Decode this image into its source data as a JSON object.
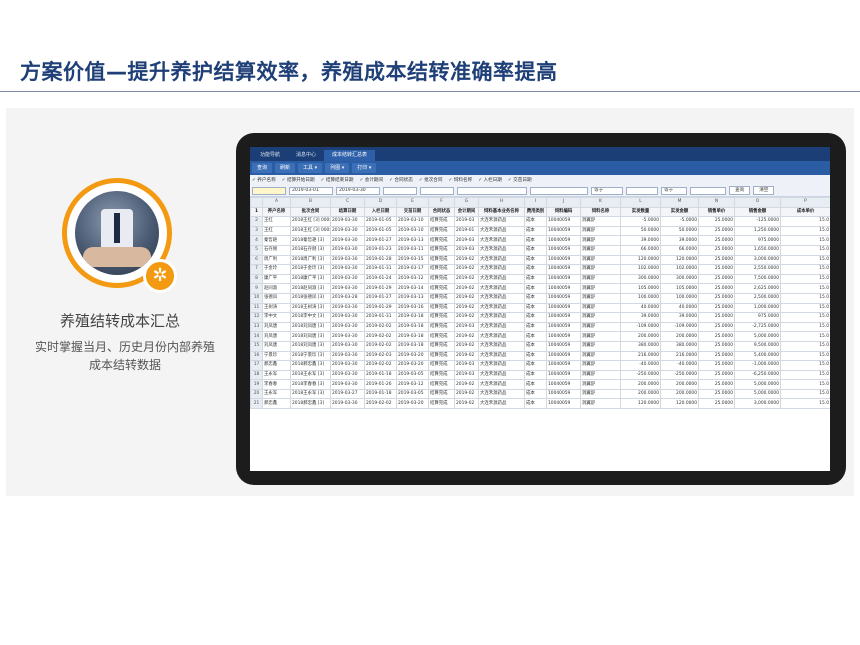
{
  "slide": {
    "title": "方案价值—提升养护结算效率，养殖成本结转准确率提高",
    "feature_title": "养殖结转成本汇总",
    "feature_desc_line1": "实时掌握当月、历史月份内部养殖",
    "feature_desc_line2": "成本结转数据",
    "badge_icon": "aperture-icon"
  },
  "colors": {
    "title": "#1f3f77",
    "accent": "#f39a12",
    "app_header": "#1a3e75",
    "app_toolbar": "#2a5da3"
  },
  "app": {
    "tabs": [
      "功能导航",
      "消息中心",
      "成本结转汇总表"
    ],
    "active_tab": 2,
    "toolbar": [
      "查询",
      "刷新",
      "工具 ▾",
      "列图 ▾",
      "打印 ▾"
    ],
    "filters": [
      "养户名称",
      "结算开始日期",
      "结算结束日期",
      "会计期间",
      "合同状态",
      "批次合同",
      "饲料名称",
      "入栏日期",
      "交苗日期"
    ],
    "filter_values": {
      "start_date": "2019-03-01",
      "end_date": "2019-03-30",
      "op1": "等于",
      "op2": "等于"
    },
    "buttons": {
      "query": "查询",
      "clear": "清空"
    },
    "column_letters": [
      "A",
      "B",
      "C",
      "D",
      "E",
      "F",
      "G",
      "H",
      "I",
      "J",
      "K",
      "L",
      "M",
      "N",
      "O",
      "P"
    ],
    "headers": [
      "养户名称",
      "批次合同",
      "结算日期",
      "入栏日期",
      "交苗日期",
      "合同状态",
      "会计期间",
      "饲料基本业务名称",
      "费用类别",
      "饲料编码",
      "饲料名称",
      "实发数量",
      "实发金额",
      "销售单价",
      "销售金额",
      "成本单价"
    ],
    "rows": [
      [
        "王红",
        "2018王红 [3] 00088",
        "2019-03-30",
        "2019-01-05",
        "2019-03-10",
        "结算完成",
        "2019-03",
        "大连禾源药品",
        "成本",
        "10040059",
        "洞翼舒",
        "-5.0000",
        "-5.0000",
        "25.0000",
        "-125.0000",
        "15.0"
      ],
      [
        "王红",
        "2018王红 [3] 00088",
        "2019-03-30",
        "2019-01-05",
        "2019-03-10",
        "结算完成",
        "2019-01",
        "大连禾源药品",
        "成本",
        "10040059",
        "洞翼舒",
        "50.0000",
        "50.0000",
        "25.0000",
        "1,250.0000",
        "15.0"
      ],
      [
        "秦哲艳",
        "2018秦哲艳 [3]",
        "2019-03-30",
        "2019-01-27",
        "2019-03-13",
        "结算完成",
        "2019-03",
        "大连禾源药品",
        "成本",
        "10040059",
        "洞翼舒",
        "39.0000",
        "39.0000",
        "25.0000",
        "975.0000",
        "15.0"
      ],
      [
        "石存刚",
        "2018石存刚 [3]",
        "2019-03-30",
        "2019-01-23",
        "2019-03-11",
        "结算完成",
        "2019-03",
        "大连禾源药品",
        "成本",
        "10040059",
        "洞翼舒",
        "66.0000",
        "66.0000",
        "25.0000",
        "1,650.0000",
        "15.0"
      ],
      [
        "周广利",
        "2018周广利 [3]",
        "2019-03-30",
        "2019-01-28",
        "2019-03-15",
        "结算完成",
        "2019-02",
        "大连禾源药品",
        "成本",
        "10040059",
        "洞翼舒",
        "120.0000",
        "120.0000",
        "25.0000",
        "3,000.0000",
        "15.0"
      ],
      [
        "于金玲",
        "2018于金玲 [3]",
        "2019-03-30",
        "2019-01-31",
        "2019-03-17",
        "结算完成",
        "2019-02",
        "大连禾源药品",
        "成本",
        "10040059",
        "洞翼舒",
        "102.0000",
        "102.0000",
        "25.0000",
        "2,550.0000",
        "15.0"
      ],
      [
        "康广平",
        "2018康广平 [3]",
        "2019-03-30",
        "2019-01-24",
        "2019-03-12",
        "结算完成",
        "2019-02",
        "大连禾源药品",
        "成本",
        "10040059",
        "洞翼舒",
        "300.0000",
        "300.0000",
        "25.0000",
        "7,500.0000",
        "15.0"
      ],
      [
        "赵同淑",
        "2018赵同淑 [3]",
        "2019-03-30",
        "2019-01-29",
        "2019-03-14",
        "结算完成",
        "2019-02",
        "大连禾源药品",
        "成本",
        "10040059",
        "洞翼舒",
        "105.0000",
        "105.0000",
        "25.0000",
        "2,625.0000",
        "15.0"
      ],
      [
        "张德凤",
        "2018张德凤 [3]",
        "2019-03-28",
        "2019-01-27",
        "2019-03-13",
        "结算完成",
        "2019-02",
        "大连禾源药品",
        "成本",
        "10040059",
        "洞翼舒",
        "100.0000",
        "100.0000",
        "25.0000",
        "2,500.0000",
        "15.0"
      ],
      [
        "王树涛",
        "2018王树涛 [3]",
        "2019-03-30",
        "2019-01-29",
        "2019-03-16",
        "结算完成",
        "2019-02",
        "大连禾源药品",
        "成本",
        "10040059",
        "洞翼舒",
        "40.0000",
        "40.0000",
        "25.0000",
        "1,000.0000",
        "15.0"
      ],
      [
        "李中文",
        "2018李中文 [3]",
        "2019-03-30",
        "2019-01-31",
        "2019-03-18",
        "结算完成",
        "2019-02",
        "大连禾源药品",
        "成本",
        "10040059",
        "洞翼舒",
        "39.0000",
        "39.0000",
        "25.0000",
        "975.0000",
        "15.0"
      ],
      [
        "刘凤唐",
        "2018刘凤唐 [3]",
        "2019-03-30",
        "2019-02-02",
        "2019-03-18",
        "结算完成",
        "2019-03",
        "大连禾源药品",
        "成本",
        "10040059",
        "洞翼舒",
        "-109.0000",
        "-109.0000",
        "25.0000",
        "-2,725.0000",
        "15.0"
      ],
      [
        "刘凤唐",
        "2018刘凤唐 [3]",
        "2019-03-30",
        "2019-02-02",
        "2019-03-18",
        "结算完成",
        "2019-02",
        "大连禾源药品",
        "成本",
        "10040059",
        "洞翼舒",
        "200.0000",
        "200.0000",
        "25.0000",
        "5,000.0000",
        "15.0"
      ],
      [
        "刘凤唐",
        "2018刘凤唐 [3]",
        "2019-03-30",
        "2019-02-02",
        "2019-03-18",
        "结算完成",
        "2019-02",
        "大连禾源药品",
        "成本",
        "10040059",
        "洞翼舒",
        "380.0000",
        "380.0000",
        "25.0000",
        "9,500.0000",
        "15.0"
      ],
      [
        "宁景珍",
        "2018宁景珍 [3]",
        "2019-03-30",
        "2019-02-03",
        "2019-03-20",
        "结算完成",
        "2019-02",
        "大连禾源药品",
        "成本",
        "10040059",
        "洞翼舒",
        "216.0000",
        "216.0000",
        "25.0000",
        "5,400.0000",
        "15.0"
      ],
      [
        "郝忠鑫",
        "2018郝忠鑫 [3]",
        "2019-03-30",
        "2019-02-02",
        "2019-03-20",
        "结算完成",
        "2019-03",
        "大连禾源药品",
        "成本",
        "10040059",
        "洞翼舒",
        "-40.0000",
        "-40.0000",
        "25.0000",
        "-1,000.0000",
        "15.0"
      ],
      [
        "王永军",
        "2018王永军 [3]",
        "2019-03-30",
        "2019-01-18",
        "2019-03-05",
        "结算完成",
        "2019-03",
        "大连禾源药品",
        "成本",
        "10040059",
        "洞翼舒",
        "-250.0000",
        "-250.0000",
        "25.0000",
        "-6,250.0000",
        "15.0"
      ],
      [
        "李春春",
        "2018李春春 [3]",
        "2019-03-30",
        "2019-01-26",
        "2019-03-12",
        "结算完成",
        "2019-02",
        "大连禾源药品",
        "成本",
        "10040059",
        "洞翼舒",
        "200.0000",
        "200.0000",
        "25.0000",
        "5,000.0000",
        "15.0"
      ],
      [
        "王永军",
        "2018王永军 [3]",
        "2019-03-27",
        "2019-01-18",
        "2019-03-05",
        "结算完成",
        "2019-02",
        "大连禾源药品",
        "成本",
        "10040059",
        "洞翼舒",
        "200.0000",
        "200.0000",
        "25.0000",
        "5,000.0000",
        "15.0"
      ],
      [
        "郝忠鑫",
        "2018郝忠鑫 [3]",
        "2019-03-30",
        "2019-02-02",
        "2019-03-20",
        "结算完成",
        "2019-02",
        "大连禾源药品",
        "成本",
        "10040059",
        "洞翼舒",
        "120.0000",
        "120.0000",
        "25.0000",
        "3,000.0000",
        "15.0"
      ]
    ]
  }
}
